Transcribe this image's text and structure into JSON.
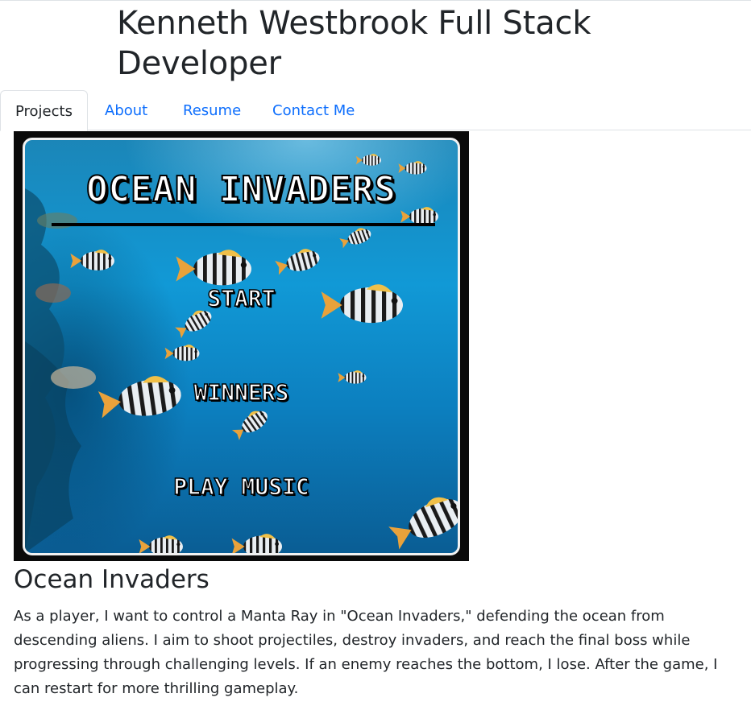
{
  "header": {
    "title": "Kenneth Westbrook Full Stack Developer"
  },
  "nav": {
    "tabs": [
      {
        "label": "Projects",
        "active": true
      },
      {
        "label": "About",
        "active": false
      },
      {
        "label": "Resume",
        "active": false
      },
      {
        "label": "Contact Me",
        "active": false
      }
    ]
  },
  "project": {
    "image": {
      "game_title": "OCEAN INVADERS",
      "menu": [
        "START",
        "WINNERS",
        "PLAY MUSIC"
      ]
    },
    "title": "Ocean Invaders",
    "description": "As a player, I want to control a Manta Ray in \"Ocean Invaders,\" defending the ocean from descending aliens. I aim to shoot projectiles, destroy invaders, and reach the final boss while progressing through challenging levels. If an enemy reaches the bottom, I lose. After the game, I can restart for more thrilling gameplay."
  },
  "colors": {
    "link": "#0d6efd",
    "text": "#212529",
    "border": "#dee2e6",
    "ocean": "#1199d6"
  }
}
